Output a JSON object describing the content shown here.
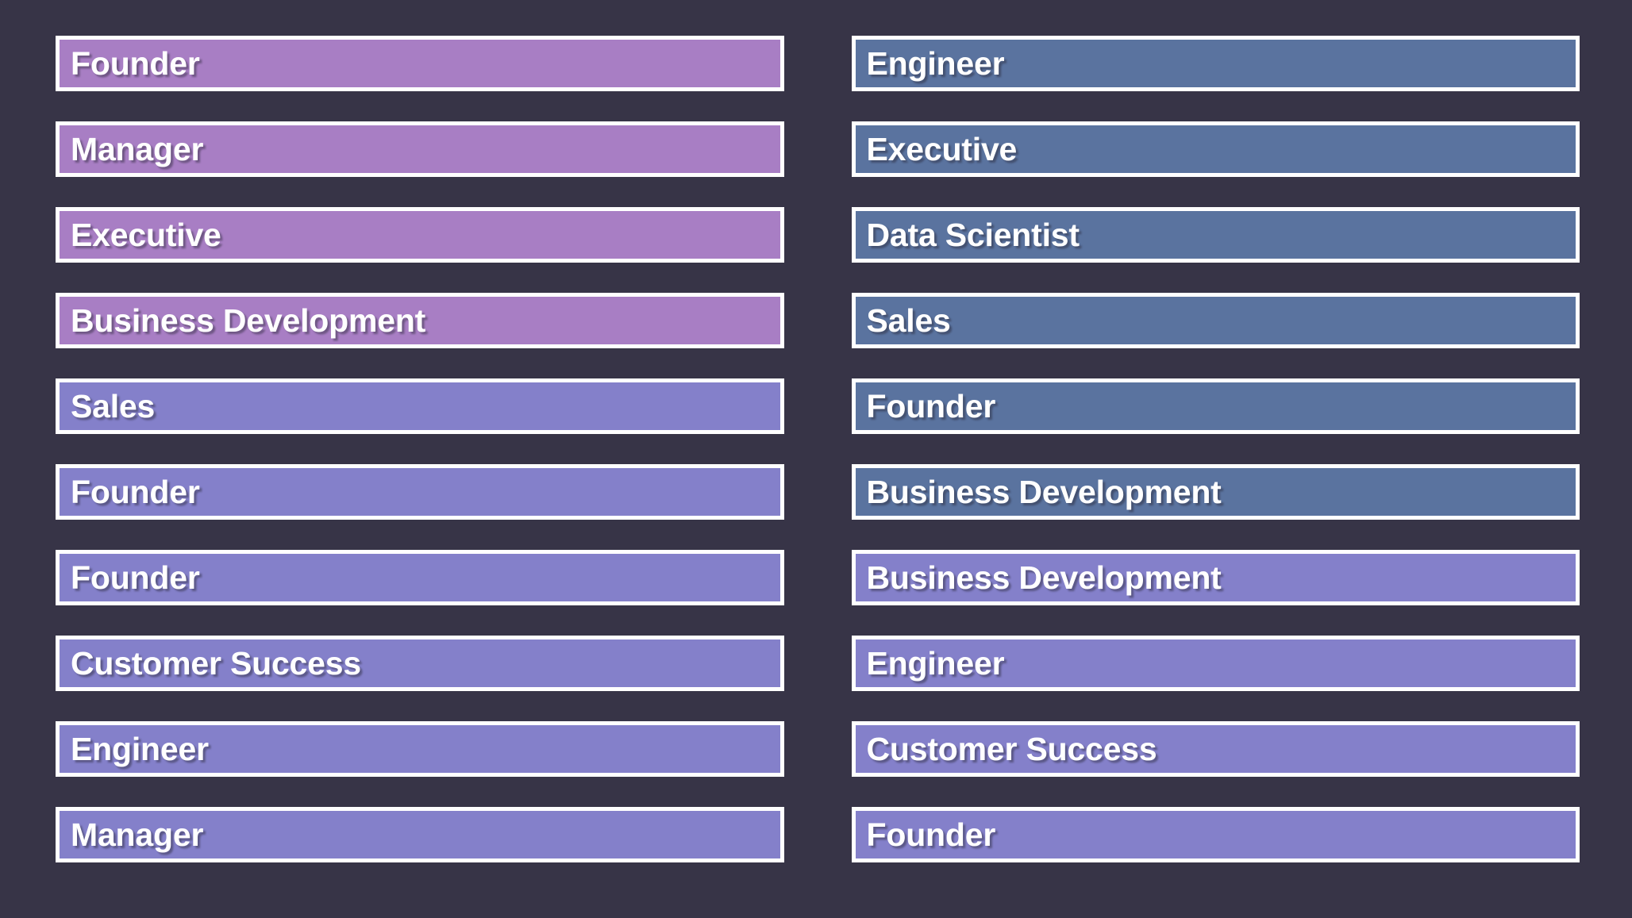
{
  "canvas": {
    "background_color": "#373447",
    "bar_border_color": "#ffffff",
    "label_color": "#ffffff"
  },
  "palette": {
    "orchid": "#a87ec4",
    "periwinkle": "#8480ca",
    "slate_blue": "#5a739f"
  },
  "chart_data": {
    "type": "bar",
    "title": "",
    "subtitle": "",
    "xlabel": "",
    "ylabel": "",
    "grid": false,
    "legend": "none",
    "orientation": "horizontal",
    "note": "Two columns of full-width horizontal label bars; bar color encodes a category group.",
    "columns": [
      {
        "name": "left-column",
        "categories": [
          "Founder",
          "Manager",
          "Executive",
          "Business Development",
          "Sales",
          "Founder",
          "Founder",
          "Customer Success",
          "Engineer",
          "Manager"
        ],
        "colors": [
          "#a87ec4",
          "#a87ec4",
          "#a87ec4",
          "#a87ec4",
          "#8480ca",
          "#8480ca",
          "#8480ca",
          "#8480ca",
          "#8480ca",
          "#8480ca"
        ]
      },
      {
        "name": "right-column",
        "categories": [
          "Engineer",
          "Executive",
          "Data Scientist",
          "Sales",
          "Founder",
          "Business Development",
          "Business Development",
          "Engineer",
          "Customer Success",
          "Founder"
        ],
        "colors": [
          "#5a739f",
          "#5a739f",
          "#5a739f",
          "#5a739f",
          "#5a739f",
          "#5a739f",
          "#8480ca",
          "#8480ca",
          "#8480ca",
          "#8480ca"
        ]
      }
    ]
  },
  "columns": [
    {
      "id": "left-column",
      "bars": [
        {
          "label": "Founder",
          "color": "#a87ec4"
        },
        {
          "label": "Manager",
          "color": "#a87ec4"
        },
        {
          "label": "Executive",
          "color": "#a87ec4"
        },
        {
          "label": "Business Development",
          "color": "#a87ec4"
        },
        {
          "label": "Sales",
          "color": "#8480ca"
        },
        {
          "label": "Founder",
          "color": "#8480ca"
        },
        {
          "label": "Founder",
          "color": "#8480ca"
        },
        {
          "label": "Customer Success",
          "color": "#8480ca"
        },
        {
          "label": "Engineer",
          "color": "#8480ca"
        },
        {
          "label": "Manager",
          "color": "#8480ca"
        }
      ]
    },
    {
      "id": "right-column",
      "bars": [
        {
          "label": "Engineer",
          "color": "#5a739f"
        },
        {
          "label": "Executive",
          "color": "#5a739f"
        },
        {
          "label": "Data Scientist",
          "color": "#5a739f"
        },
        {
          "label": "Sales",
          "color": "#5a739f"
        },
        {
          "label": "Founder",
          "color": "#5a739f"
        },
        {
          "label": "Business Development",
          "color": "#5a739f"
        },
        {
          "label": "Business Development",
          "color": "#8480ca"
        },
        {
          "label": "Engineer",
          "color": "#8480ca"
        },
        {
          "label": "Customer Success",
          "color": "#8480ca"
        },
        {
          "label": "Founder",
          "color": "#8480ca"
        }
      ]
    }
  ]
}
